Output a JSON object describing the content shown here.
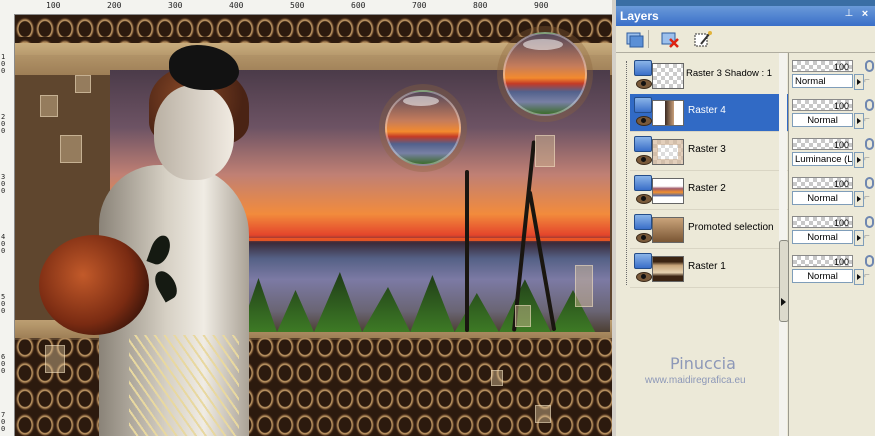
{
  "ruler": {
    "top_labels": [
      "100",
      "200",
      "300",
      "400",
      "500",
      "600",
      "700",
      "800",
      "900"
    ],
    "left_labels": [
      "1 0 0",
      "2 0 0",
      "3 0 0",
      "4 0 0",
      "5 0 0",
      "6 0 0",
      "7 0 0"
    ]
  },
  "panel": {
    "title": "Layers",
    "pin_glyph": "⊥",
    "close_glyph": "×"
  },
  "layers": [
    {
      "name": "Raster 3 Shadow : 1",
      "opacity": "100",
      "blend": "Normal",
      "selected": false
    },
    {
      "name": "Raster 4",
      "opacity": "100",
      "blend": "Normal",
      "selected": true
    },
    {
      "name": "Raster 3",
      "opacity": "100",
      "blend": "Luminance (L)",
      "selected": false
    },
    {
      "name": "Raster 2",
      "opacity": "100",
      "blend": "Normal",
      "selected": false
    },
    {
      "name": "Promoted selection",
      "opacity": "100",
      "blend": "Normal",
      "selected": false
    },
    {
      "name": "Raster 1",
      "opacity": "100",
      "blend": "Normal",
      "selected": false
    }
  ],
  "watermark": {
    "name": "Pinuccia",
    "site": "www.maidiregrafica.eu"
  },
  "colors": {
    "selection": "#316ac5",
    "title_bar": "#3a6fc8",
    "panel_bg": "#ece9d8"
  },
  "icons": [
    "new-layer-icon",
    "delete-layer-icon",
    "edit-mask-icon",
    "eye-icon",
    "link-icon",
    "lock-icon"
  ]
}
